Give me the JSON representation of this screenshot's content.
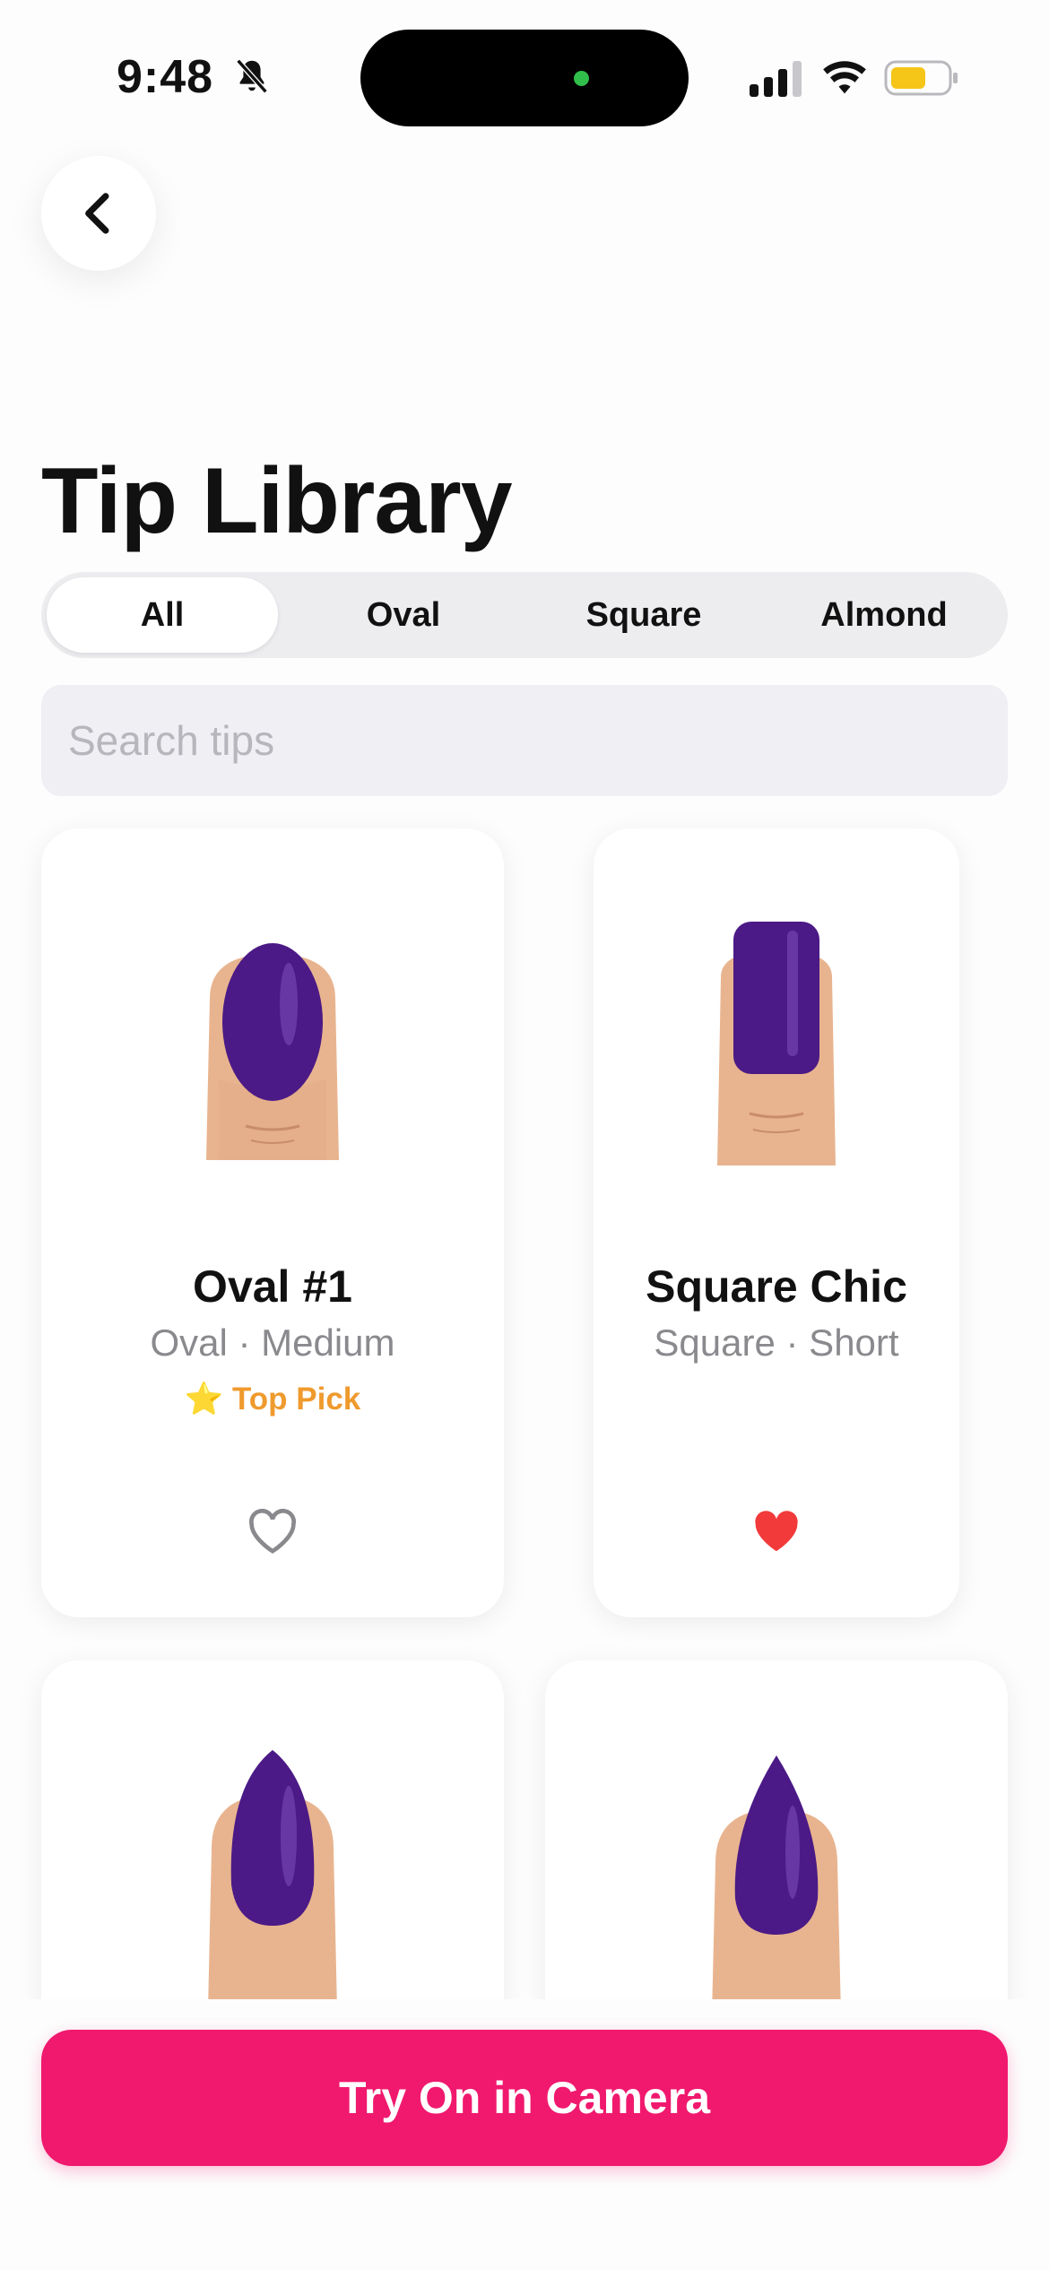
{
  "status_bar": {
    "time": "9:48",
    "icons": [
      "bell-slash-icon",
      "cellular-signal-icon",
      "wifi-icon",
      "battery-icon"
    ],
    "battery_color": "#f5c518"
  },
  "header": {
    "back_icon": "chevron-left-icon",
    "title": "Tip Library"
  },
  "filters": {
    "tabs": [
      {
        "label": "All",
        "selected": true
      },
      {
        "label": "Oval",
        "selected": false
      },
      {
        "label": "Square",
        "selected": false
      },
      {
        "label": "Almond",
        "selected": false
      }
    ]
  },
  "search": {
    "placeholder": "Search tips",
    "value": ""
  },
  "tips": [
    {
      "name": "Oval #1",
      "subtitle": "Oval · Medium",
      "badge": "⭐ Top Pick",
      "favorite": false,
      "shape": "oval"
    },
    {
      "name": "Square Chic",
      "subtitle": "Square · Short",
      "badge": "",
      "favorite": true,
      "shape": "square"
    },
    {
      "name": "",
      "subtitle": "",
      "badge": "",
      "shape": "almond"
    },
    {
      "name": "",
      "subtitle": "",
      "badge": "",
      "shape": "stiletto"
    }
  ],
  "colors": {
    "accent": "#f0196e",
    "nail_polish": "#4b1a86",
    "favorite_heart": "#f23a3a",
    "top_pick": "#ef9a2d"
  },
  "cta": {
    "label": "Try On in Camera"
  }
}
